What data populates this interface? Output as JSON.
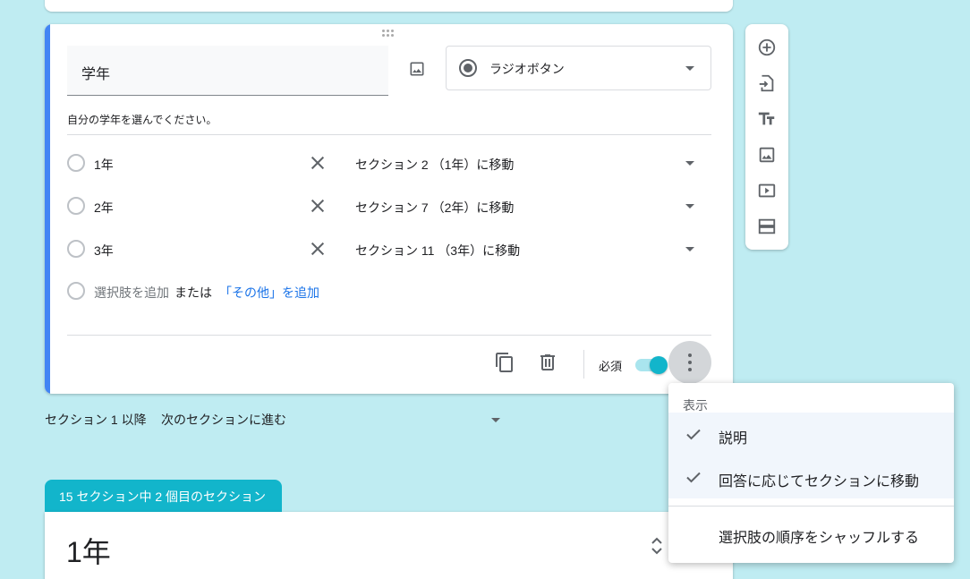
{
  "question": {
    "title": "学年",
    "type_label": "ラジオボタン",
    "description": "自分の学年を選んでください。",
    "options": [
      {
        "label": "1年",
        "goto": "セクション 2 （1年）に移動"
      },
      {
        "label": "2年",
        "goto": "セクション 7 （2年）に移動"
      },
      {
        "label": "3年",
        "goto": "セクション 11 （3年）に移動"
      }
    ],
    "add_option": "選択肢を追加",
    "or_text": "または",
    "add_other": "「その他」を追加",
    "required_label": "必須",
    "required": true
  },
  "after_section": {
    "label": "セクション 1 以降",
    "value": "次のセクションに進む"
  },
  "section": {
    "tab_label": "15 セクション中 2 個目のセクション",
    "title": "1年"
  },
  "menu": {
    "header": "表示",
    "items": [
      {
        "label": "説明",
        "checked": true
      },
      {
        "label": "回答に応じてセクションに移動",
        "checked": true
      },
      {
        "label": "選択肢の順序をシャッフルする",
        "checked": false
      }
    ]
  },
  "colors": {
    "background": "#bfecf2",
    "accent": "#12b5cb",
    "active_bar": "#4285f4",
    "link": "#1a73e8"
  },
  "toolbar_icons": [
    "add-question-icon",
    "import-questions-icon",
    "add-title-icon",
    "add-image-icon",
    "add-video-icon",
    "add-section-icon"
  ]
}
